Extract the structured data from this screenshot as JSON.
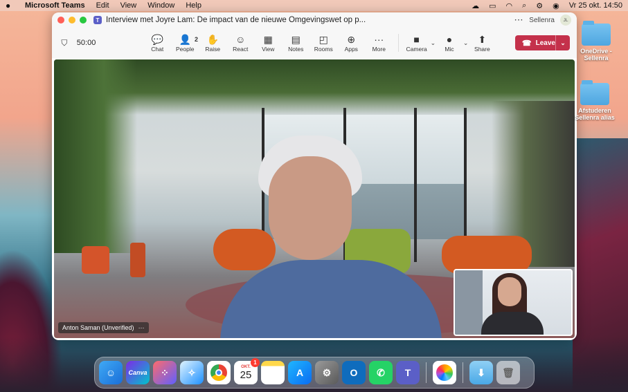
{
  "menubar": {
    "app": "Microsoft Teams",
    "items": [
      "Edit",
      "View",
      "Window",
      "Help"
    ],
    "datetime": "Vr 25 okt.  14:50"
  },
  "window": {
    "title": "Interview met Joyre Lam: De impact van de nieuwe Omgevingswet op p...",
    "user": "Sellenra",
    "user_initials": "JL"
  },
  "toolbar": {
    "timer": "50:00",
    "tools": [
      {
        "label": "Chat",
        "icon": "chat-icon",
        "glyph": "💬"
      },
      {
        "label": "People",
        "icon": "people-icon",
        "glyph": "👤",
        "badge": "2"
      },
      {
        "label": "Raise",
        "icon": "raise-hand-icon",
        "glyph": "✋"
      },
      {
        "label": "React",
        "icon": "react-icon",
        "glyph": "☺"
      },
      {
        "label": "View",
        "icon": "view-grid-icon",
        "glyph": "▦"
      },
      {
        "label": "Notes",
        "icon": "notes-icon",
        "glyph": "▤"
      },
      {
        "label": "Rooms",
        "icon": "rooms-icon",
        "glyph": "◰"
      },
      {
        "label": "Apps",
        "icon": "apps-icon",
        "glyph": "⊕"
      },
      {
        "label": "More",
        "icon": "more-icon",
        "glyph": "···"
      }
    ],
    "camera_label": "Camera",
    "mic_label": "Mic",
    "share_label": "Share",
    "leave_label": "Leave"
  },
  "stage": {
    "speaker_name": "Anton Saman (Unverified)"
  },
  "desktop": {
    "icons": [
      {
        "label": "OneDrive - Sellenra"
      },
      {
        "label": "Afstuderen Sellenra alias"
      }
    ]
  },
  "dock": {
    "calendar_month": "OKT.",
    "calendar_day": "25",
    "calendar_badge": "1",
    "canva_label": "Canva"
  }
}
